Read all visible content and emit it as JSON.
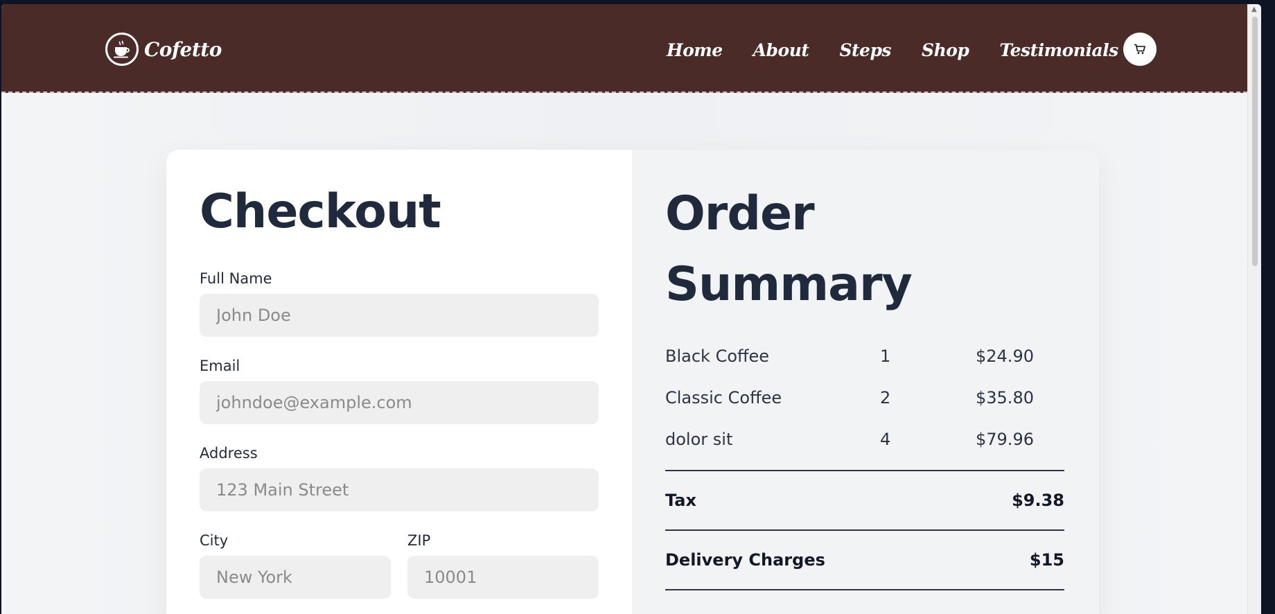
{
  "brand": {
    "name": "Cofetto"
  },
  "nav": {
    "links": [
      "Home",
      "About",
      "Steps",
      "Shop",
      "Testimonials"
    ],
    "cart_icon": "cart-icon"
  },
  "checkout": {
    "title": "Checkout",
    "fields": {
      "full_name": {
        "label": "Full Name",
        "placeholder": "John Doe"
      },
      "email": {
        "label": "Email",
        "placeholder": "johndoe@example.com"
      },
      "address": {
        "label": "Address",
        "placeholder": "123 Main Street"
      },
      "city": {
        "label": "City",
        "placeholder": "New York"
      },
      "zip": {
        "label": "ZIP",
        "placeholder": "10001"
      }
    }
  },
  "summary": {
    "title": "Order Summary",
    "items": [
      {
        "name": "Black Coffee",
        "qty": "1",
        "price": "$24.90"
      },
      {
        "name": "Classic Coffee",
        "qty": "2",
        "price": "$35.80"
      },
      {
        "name": "dolor sit",
        "qty": "4",
        "price": "$79.96"
      }
    ],
    "tax": {
      "label": "Tax",
      "value": "$9.38"
    },
    "delivery": {
      "label": "Delivery Charges",
      "value": "$15"
    }
  },
  "colors": {
    "navbar": "#4a2b27",
    "heading": "#1f2a3c",
    "field_bg": "#efefef"
  }
}
